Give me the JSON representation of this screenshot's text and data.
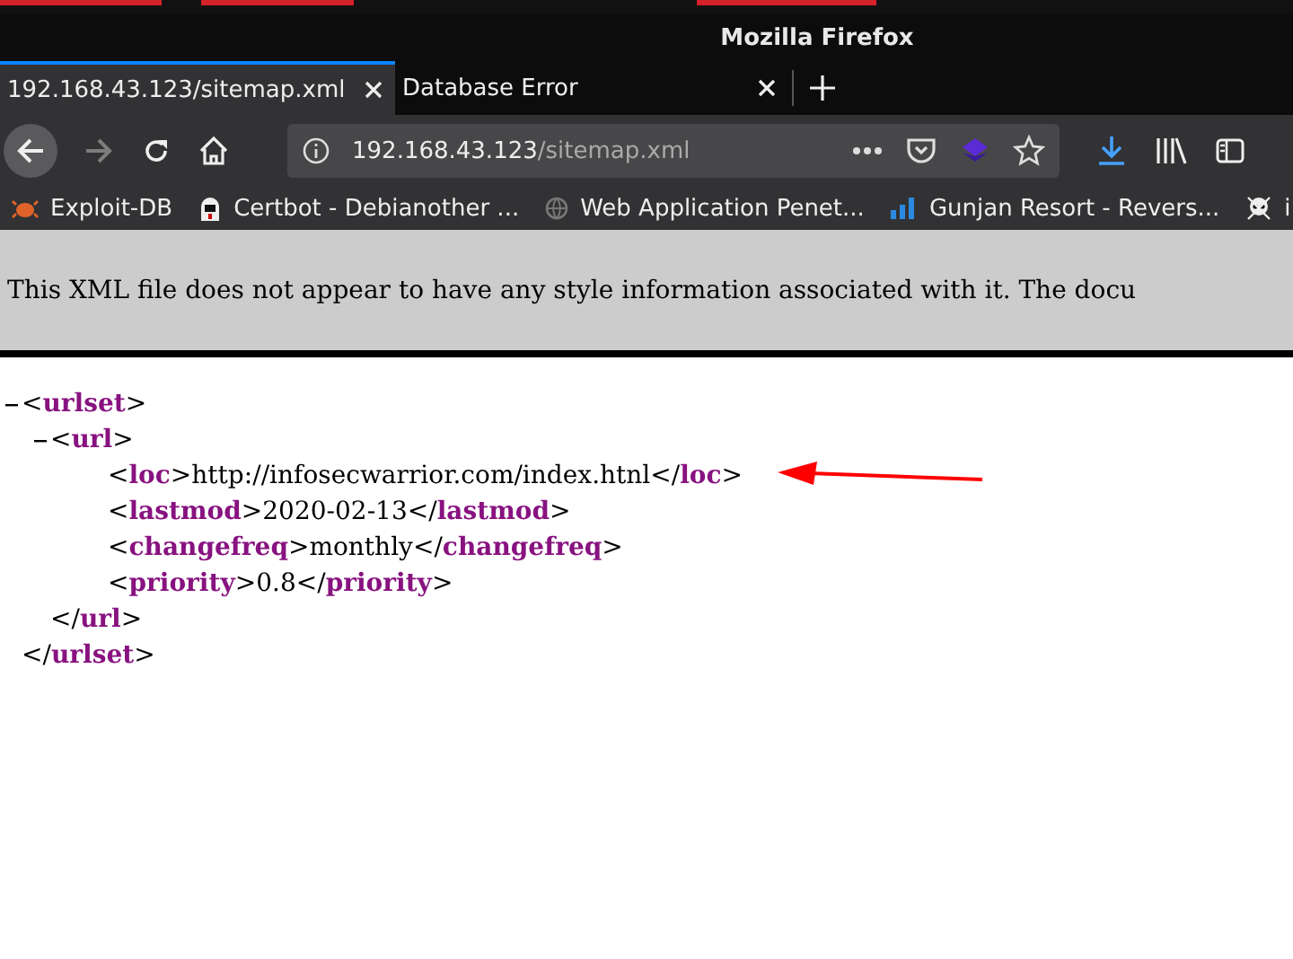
{
  "window": {
    "title": "Mozilla Firefox"
  },
  "tabs": [
    {
      "label": "192.168.43.123/sitemap.xml",
      "selected": true
    },
    {
      "label": "Database Error",
      "selected": false
    }
  ],
  "toolbar": {
    "back_disabled": false,
    "forward_disabled": true,
    "address": {
      "host": "192.168.43.123",
      "path": "/sitemap.xml"
    }
  },
  "bookmarks": [
    {
      "label": "Exploit-DB"
    },
    {
      "label": "Certbot - Debianother ..."
    },
    {
      "label": "Web Application Penet..."
    },
    {
      "label": "Gunjan Resort - Revers..."
    },
    {
      "label": "i"
    }
  ],
  "info_bar": {
    "text": "This XML file does not appear to have any style information associated with it. The docu"
  },
  "xml_tree": [
    {
      "open": "<**urlset**>",
      "close": "</**urlset**>",
      "expanded": true,
      "children": [
        {
          "open": "<**url**>",
          "close": "</**url**>",
          "expanded": true,
          "children": [
            {
              "line": "<**loc**>http://infosecwarrior.com/index.htnl</**loc**>"
            },
            {
              "line": "<**lastmod**>2020-02-13</**lastmod**>"
            },
            {
              "line": "<**changefreq**>monthly</**changefreq**>"
            },
            {
              "line": "<**priority**>0.8</**priority**>"
            }
          ]
        }
      ]
    }
  ]
}
